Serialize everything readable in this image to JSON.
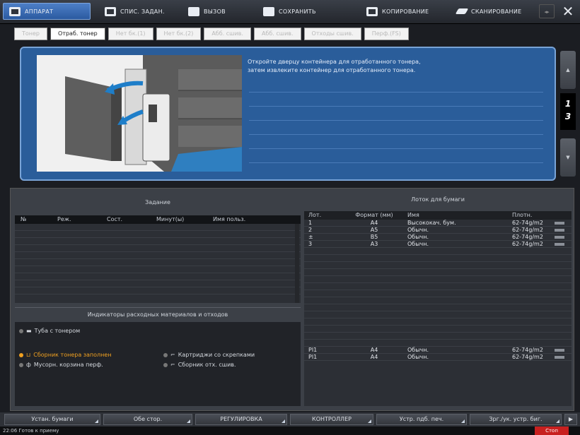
{
  "topbar": {
    "items": [
      {
        "label": "АППАРАТ",
        "active": true
      },
      {
        "label": "СПИС. ЗАДАН.",
        "active": false
      },
      {
        "label": "ВЫЗОВ",
        "active": false
      },
      {
        "label": "СОХРАНИТЬ",
        "active": false
      },
      {
        "label": "КОПИРОВАНИЕ",
        "active": false
      },
      {
        "label": "СКАНИРОВАНИЕ",
        "active": false
      }
    ],
    "close_label": "✕"
  },
  "subtabs": [
    "Тонер",
    "Отраб. тонер",
    "Нет бк.(1)",
    "Нет бк.(2)",
    "Абб. сшив.",
    "Абб. сшив.",
    "Отходы сшив.",
    "Перф.(FS)"
  ],
  "guide": {
    "line1": "Откройте дверцу контейнера для отработанного тонера,",
    "line2": "затем извлеките контейнер для отработанного тонера."
  },
  "pager": {
    "current": "1",
    "total": "3"
  },
  "job_panel": {
    "title": "Задание",
    "columns": [
      "№",
      "Реж.",
      "Сост.",
      "Минут(ы)",
      "Имя польз."
    ]
  },
  "consumables": {
    "title": "Индикаторы расходных материалов и отходов",
    "items": [
      {
        "label": "Туба с тонером",
        "status": "ok"
      },
      {
        "label": "Сборник тонера заполнен",
        "status": "warn"
      },
      {
        "label": "Картриджи со скрепками",
        "status": "ok"
      },
      {
        "label": "Мусорн. корзина перф.",
        "status": "ok"
      },
      {
        "label": "Сборник отх. сшив.",
        "status": "ok"
      }
    ]
  },
  "tray_panel": {
    "title": "Лоток для бумаги",
    "columns": [
      "Лот.",
      "Формат (мм)",
      "Имя",
      "Плотн."
    ],
    "rows": [
      {
        "tray": "1",
        "format": "A4",
        "name": "Высококач. бум.",
        "weight": "62-74g/m2"
      },
      {
        "tray": "2",
        "format": "A5",
        "name": "Обычн.",
        "weight": "62-74g/m2"
      },
      {
        "tray": "±",
        "format": "B5",
        "name": "Обычн.",
        "weight": "62-74g/m2"
      },
      {
        "tray": "3",
        "format": "A3",
        "name": "Обычн.",
        "weight": "62-74g/m2"
      }
    ],
    "pi_rows": [
      {
        "tray": "PI1",
        "format": "A4",
        "name": "Обычн.",
        "weight": "62-74g/m2"
      },
      {
        "tray": "PI1",
        "format": "A4",
        "name": "Обычн.",
        "weight": "62-74g/m2"
      }
    ]
  },
  "bottombar": [
    "Устан. бумаги",
    "Обе стор.",
    "РЕГУЛИРОВКА",
    "КОНТРОЛЛЕР",
    "Устр. пдб. печ.",
    "Зрг./ук. устр. биг."
  ],
  "status": {
    "text": "22:06  Готов к приему",
    "stop_label": "Стоп"
  },
  "colors": {
    "accent_blue": "#2a5d9a",
    "warn_orange": "#f0a020",
    "stop_red": "#c8201f"
  }
}
